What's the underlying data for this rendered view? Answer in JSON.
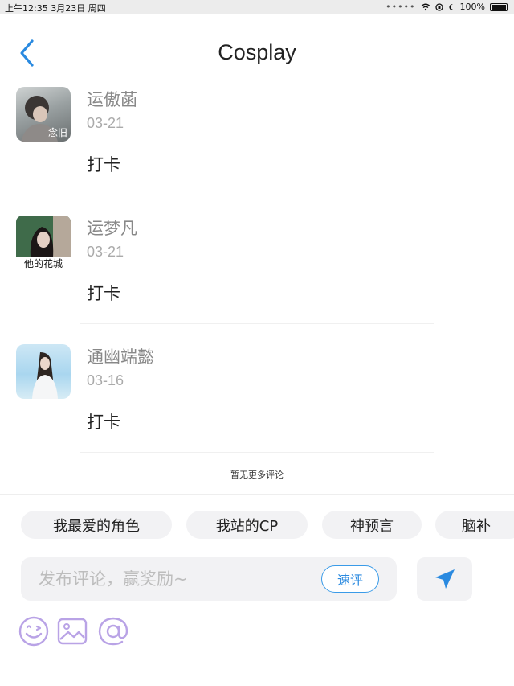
{
  "status_bar": {
    "left_text": "上午12:35   3月23日 周四",
    "signal": "•••••",
    "battery_text": "100%"
  },
  "header": {
    "title": "Cosplay"
  },
  "comments": [
    {
      "name": "运傲菡",
      "date": "03-21",
      "text": "打卡",
      "avatar_caption": "念旧"
    },
    {
      "name": "运梦凡",
      "date": "03-21",
      "text": "打卡",
      "avatar_caption": "他的花城"
    },
    {
      "name": "通幽端懿",
      "date": "03-16",
      "text": "打卡",
      "avatar_caption": ""
    }
  ],
  "no_more_text": "暂无更多评论",
  "quick_tags": [
    "我最爱的角色",
    "我站的CP",
    "神预言",
    "脑补"
  ],
  "composer": {
    "placeholder": "发布评论，赢奖励~",
    "quick_review_label": "速评"
  },
  "colors": {
    "accent": "#2a8ae0",
    "tool_icon": "#b9a3e6"
  },
  "icons": {
    "back": "chevron-left-icon",
    "send": "paper-plane-icon",
    "emoji": "emoji-icon",
    "image": "image-icon",
    "mention": "at-icon"
  }
}
